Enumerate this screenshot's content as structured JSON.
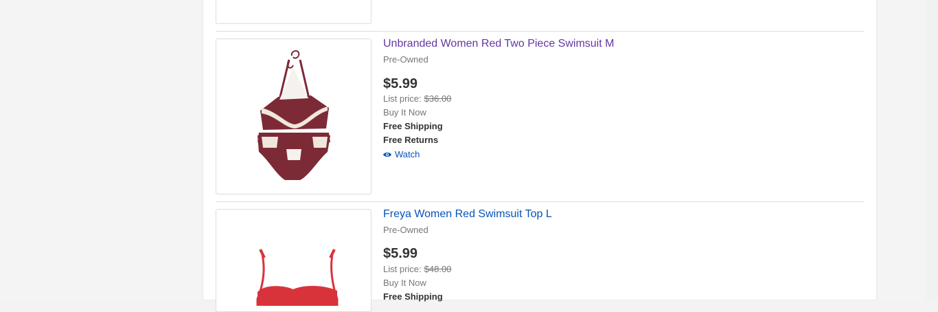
{
  "colors": {
    "link": "#0654ba",
    "visited_link": "#6435a3",
    "price": "#333333",
    "muted": "#767676",
    "swimsuit_burgundy": "#7d2a37",
    "swimsuit_red": "#d8333b"
  },
  "listings": [
    {
      "title": "Unbranded Women Red Two Piece Swimsuit M",
      "condition": "Pre-Owned",
      "price": "$5.99",
      "list_price_label": "List price:",
      "list_price": "$36.00",
      "format": "Buy It Now",
      "shipping": "Free Shipping",
      "returns": "Free Returns",
      "watch_label": "Watch",
      "watch_icon": "eye-icon",
      "visited": true
    },
    {
      "title": "Freya Women Red Swimsuit Top L",
      "condition": "Pre-Owned",
      "price": "$5.99",
      "list_price_label": "List price:",
      "list_price": "$48.00",
      "format": "Buy It Now",
      "shipping": "Free Shipping",
      "visited": false
    }
  ]
}
